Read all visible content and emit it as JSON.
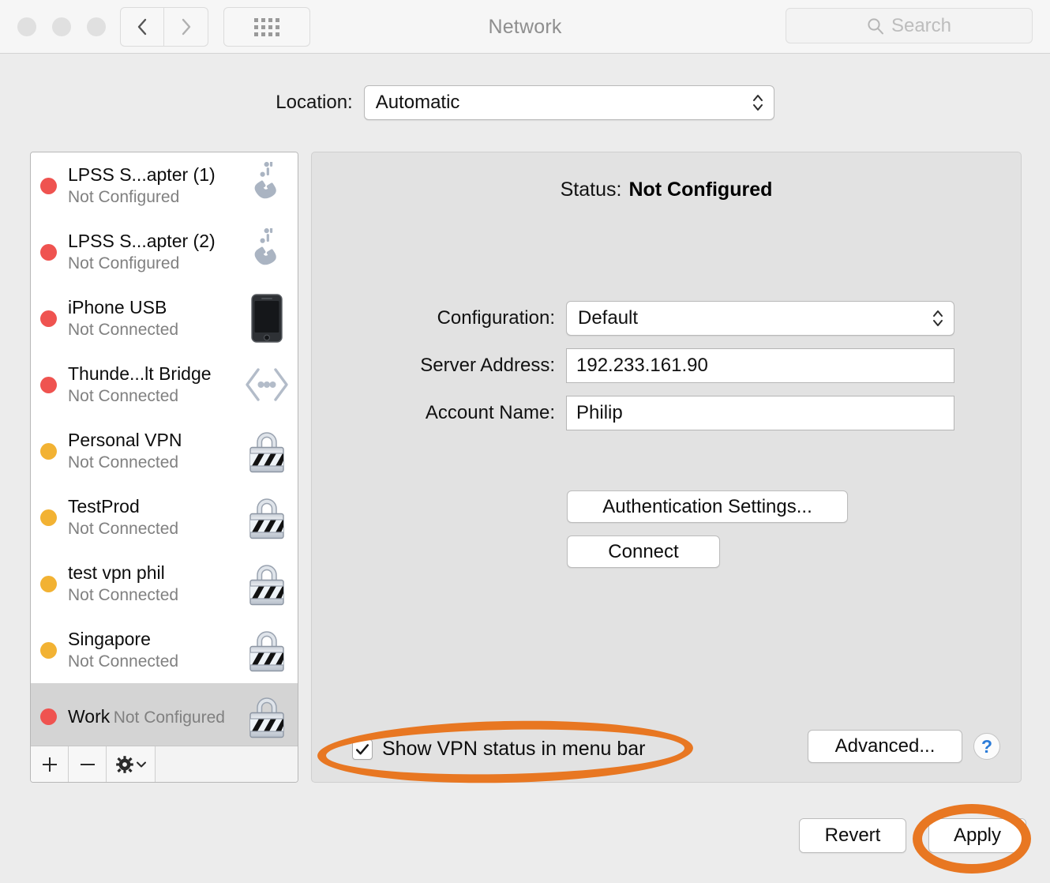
{
  "window": {
    "title": "Network",
    "traffic_lights": [
      "close",
      "minimize",
      "zoom"
    ],
    "nav": {
      "back_icon": "chevron-left-icon",
      "forward_icon": "chevron-right-icon"
    },
    "show_all_icon": "grid-icon"
  },
  "search": {
    "placeholder": "Search",
    "icon": "search-icon",
    "value": ""
  },
  "location": {
    "label": "Location:",
    "value": "Automatic",
    "options": [
      "Automatic"
    ]
  },
  "services": [
    {
      "name": "LPSS S...apter (1)",
      "status": "Not Configured",
      "dot": "red",
      "icon": "modem-icon",
      "selected": false
    },
    {
      "name": "LPSS S...apter (2)",
      "status": "Not Configured",
      "dot": "red",
      "icon": "modem-icon",
      "selected": false
    },
    {
      "name": "iPhone USB",
      "status": "Not Connected",
      "dot": "red",
      "icon": "iphone-icon",
      "selected": false
    },
    {
      "name": "Thunde...lt Bridge",
      "status": "Not Connected",
      "dot": "red",
      "icon": "thunderbolt-bridge-icon",
      "selected": false
    },
    {
      "name": "Personal VPN",
      "status": "Not Connected",
      "dot": "yellow",
      "icon": "vpn-lock-icon",
      "selected": false
    },
    {
      "name": "TestProd",
      "status": "Not Connected",
      "dot": "yellow",
      "icon": "vpn-lock-icon",
      "selected": false
    },
    {
      "name": "test vpn phil",
      "status": "Not Connected",
      "dot": "yellow",
      "icon": "vpn-lock-icon",
      "selected": false
    },
    {
      "name": "Singapore",
      "status": "Not Connected",
      "dot": "yellow",
      "icon": "vpn-lock-icon",
      "selected": false
    },
    {
      "name": "Work",
      "status": "Not Configured",
      "dot": "red",
      "icon": "vpn-lock-icon",
      "selected": true
    }
  ],
  "list_toolbar": {
    "add_label": "+",
    "remove_label": "−",
    "action_icon": "gear-icon",
    "action_chevron_icon": "chevron-down-icon"
  },
  "detail": {
    "status_label": "Status:",
    "status_value": "Not Configured",
    "fields": [
      {
        "label": "Configuration:",
        "value": "Default",
        "type": "popup"
      },
      {
        "label": "Server Address:",
        "value": "192.233.161.90",
        "type": "text"
      },
      {
        "label": "Account Name:",
        "value": "Philip",
        "type": "text"
      }
    ],
    "auth_button": "Authentication Settings...",
    "connect_button": "Connect",
    "checkbox": {
      "label": "Show VPN status in menu bar",
      "checked": true
    },
    "advanced_button": "Advanced...",
    "help_button": "?"
  },
  "footer": {
    "revert_button": "Revert",
    "apply_button": "Apply"
  },
  "annotations": {
    "color": "#e87722",
    "targets": [
      "show-vpn-status-checkbox-row",
      "apply-button"
    ]
  },
  "colors": {
    "window_bg": "#ececec",
    "titlebar_bg": "#f6f6f6",
    "detail_bg": "#e2e2e2",
    "selected_row": "#d4d4d4",
    "dot_red": "#ef5350",
    "dot_yellow": "#f2b233",
    "annotation_orange": "#e87722",
    "help_blue": "#2a7bd8"
  }
}
